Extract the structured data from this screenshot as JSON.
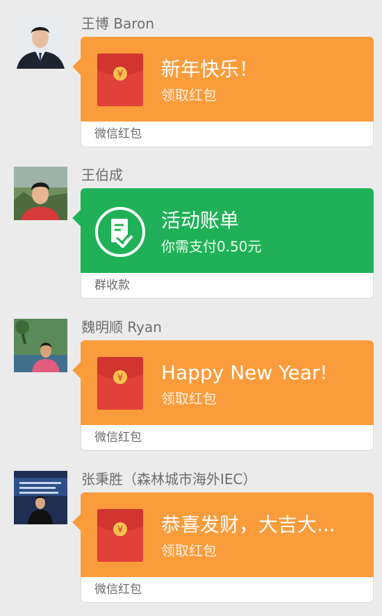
{
  "messages": [
    {
      "sender": "王博 Baron",
      "title": "新年快乐！",
      "subtitle": "领取红包",
      "footer": "微信红包",
      "color": "#fa9c3b",
      "icon": "red-packet-icon"
    },
    {
      "sender": "王伯成",
      "title": "活动账单",
      "subtitle": "你需支付0.50元",
      "footer": "群收款",
      "color": "#20b158",
      "icon": "bill-icon"
    },
    {
      "sender": "魏明顺 Ryan",
      "title": "Happy New Year!",
      "subtitle": "领取红包",
      "footer": "微信红包",
      "color": "#fa9c3b",
      "icon": "red-packet-icon"
    },
    {
      "sender": "张秉胜（森林城市海外IEC）",
      "title": "恭喜发财，大吉大...",
      "subtitle": "领取红包",
      "footer": "微信红包",
      "color": "#fa9c3b",
      "icon": "red-packet-icon"
    }
  ],
  "packet_symbol": "¥"
}
